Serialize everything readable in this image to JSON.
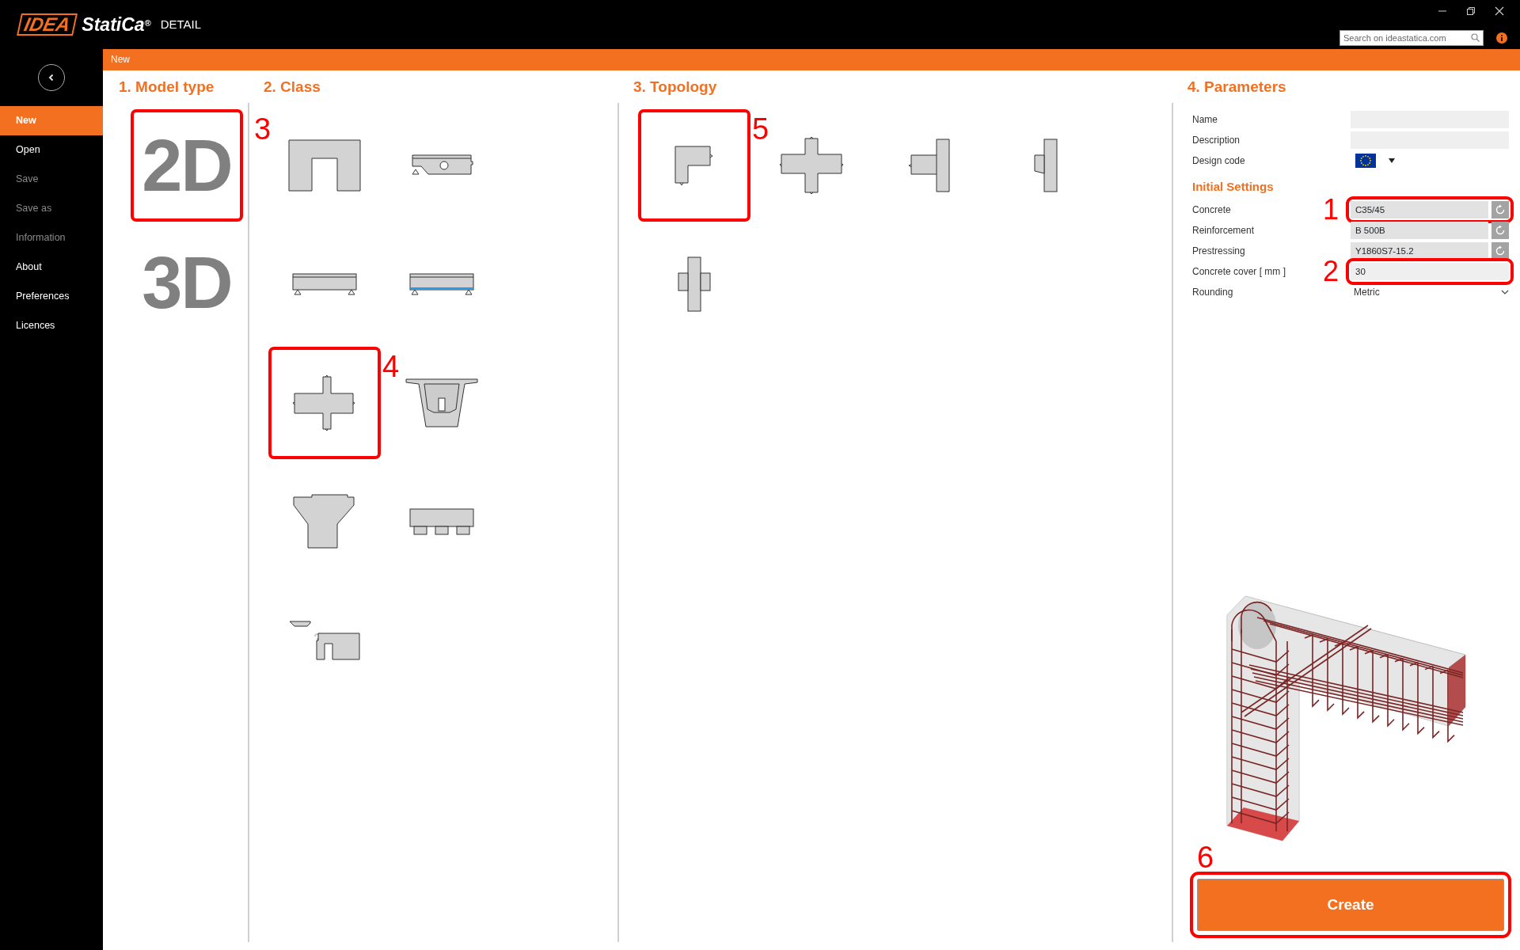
{
  "app": {
    "logo": "IDEA",
    "name": "StatiCa$^{®}$",
    "product": "DETAIL"
  },
  "search": {
    "placeholder": "Search on ideastatica.com"
  },
  "breadcrumb": "New",
  "sidebar": {
    "items": [
      {
        "label": "New",
        "selected": true,
        "disabled": false
      },
      {
        "label": "Open",
        "selected": false,
        "disabled": false
      },
      {
        "label": "Save",
        "selected": false,
        "disabled": true
      },
      {
        "label": "Save as",
        "selected": false,
        "disabled": true
      },
      {
        "label": "Information",
        "selected": false,
        "disabled": true
      },
      {
        "label": "About",
        "selected": false,
        "disabled": false
      },
      {
        "label": "Preferences",
        "selected": false,
        "disabled": false
      },
      {
        "label": "Licences",
        "selected": false,
        "disabled": false
      }
    ]
  },
  "model_type": {
    "title": "1. Model type",
    "options": [
      {
        "label": "2D",
        "highlighted": true,
        "callout": "3"
      },
      {
        "label": "3D",
        "highlighted": false
      }
    ]
  },
  "class": {
    "title": "2. Class",
    "options": [
      {
        "highlighted": false
      },
      {
        "highlighted": false
      },
      {
        "highlighted": false
      },
      {
        "highlighted": false
      },
      {
        "highlighted": true,
        "callout": "4"
      },
      {
        "highlighted": false
      },
      {
        "highlighted": false
      },
      {
        "highlighted": false
      },
      {
        "highlighted": false
      }
    ]
  },
  "topology": {
    "title": "3. Topology",
    "options": [
      {
        "highlighted": true,
        "callout": "5"
      },
      {
        "highlighted": false
      },
      {
        "highlighted": false
      },
      {
        "highlighted": false
      },
      {
        "highlighted": false
      }
    ]
  },
  "parameters": {
    "title": "4. Parameters",
    "fields": [
      {
        "label": "Name",
        "kind": "text"
      },
      {
        "label": "Description",
        "kind": "text"
      },
      {
        "label": "Design code",
        "kind": "flag"
      }
    ],
    "initial_settings": {
      "title": "Initial Settings",
      "fields": [
        {
          "label": "Concrete",
          "kind": "material",
          "value": "C35/45",
          "highlighted": true,
          "callout": "1"
        },
        {
          "label": "Reinforcement",
          "kind": "material",
          "value": "B 500B",
          "highlighted": false
        },
        {
          "label": "Prestressing",
          "kind": "material",
          "value": "Y1860S7-15.2",
          "highlighted": false
        },
        {
          "label": "Concrete cover [ mm ]",
          "kind": "text",
          "value": "30",
          "highlighted": true,
          "callout": "2"
        },
        {
          "label": "Rounding",
          "kind": "dropdown",
          "value": "Metric",
          "highlighted": false
        }
      ]
    }
  },
  "create": {
    "label": "Create",
    "highlighted": true,
    "callout": "6"
  }
}
